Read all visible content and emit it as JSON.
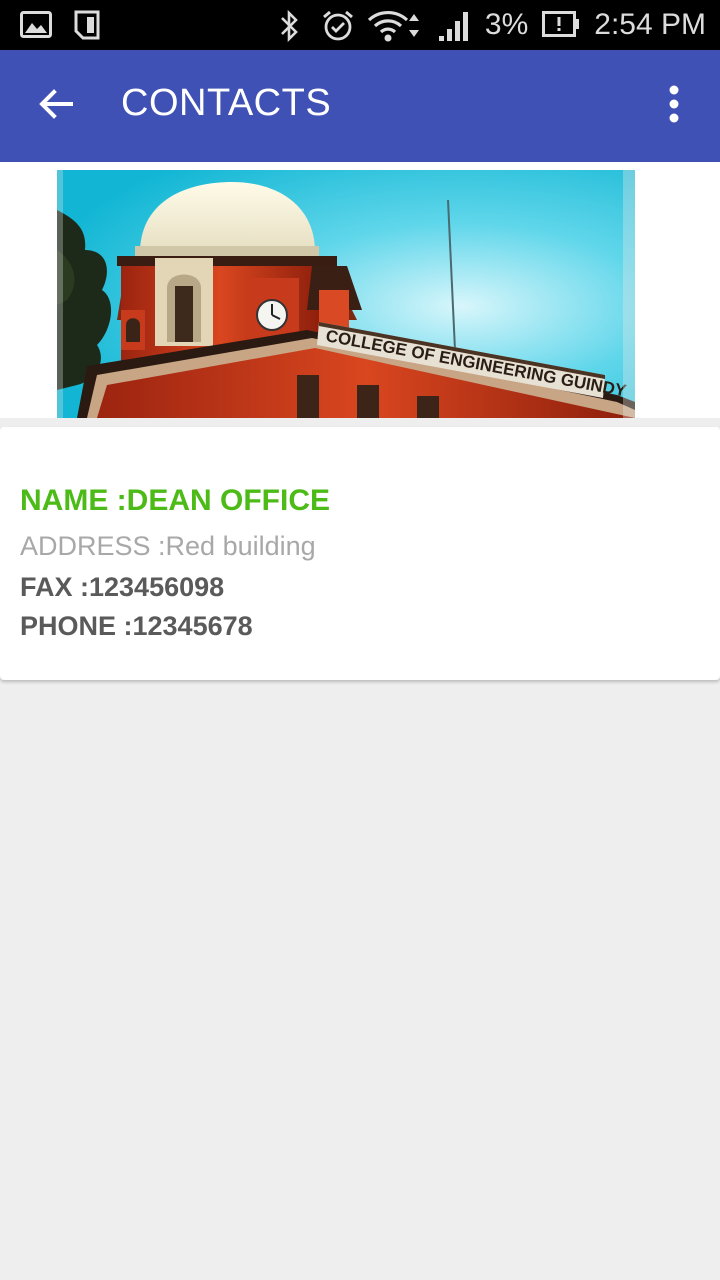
{
  "status_bar": {
    "battery_percent": "3%",
    "time": "2:54 PM",
    "icons": [
      "gallery-icon",
      "sim-card-icon",
      "bluetooth-icon",
      "alarm-icon",
      "wifi-icon",
      "signal-icon",
      "battery-alert-icon"
    ]
  },
  "app_bar": {
    "title": "CONTACTS",
    "back_icon": "arrow-back-icon",
    "menu_icon": "more-vert-icon",
    "color": "#3f51b5"
  },
  "banner": {
    "sign_text": "COLLEGE OF ENGINEERING GUINDY"
  },
  "contact": {
    "name": "NAME :DEAN OFFICE",
    "address": "ADDRESS :Red building",
    "fax": "FAX :123456098",
    "phone": "PHONE :12345678",
    "name_color": "#4cbb17"
  }
}
